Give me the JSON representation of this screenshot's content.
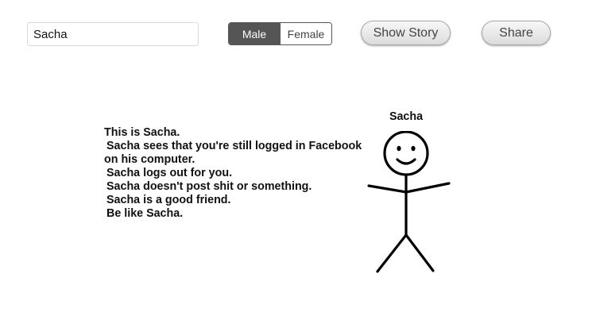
{
  "name_input": {
    "value": "Sacha"
  },
  "gender_toggle": {
    "options": [
      "Male",
      "Female"
    ],
    "selected": "Male"
  },
  "buttons": {
    "show_story": "Show Story",
    "share": "Share"
  },
  "figure": {
    "name": "Sacha",
    "icon": "stick-figure-smiling"
  },
  "story": {
    "lines": [
      "This is Sacha.",
      "Sacha sees that you're still logged in Facebook",
      "on his computer.",
      "Sacha logs out for you.",
      "Sacha doesn't post shit or something.",
      "Sacha is a good friend.",
      "Be like Sacha."
    ]
  },
  "colors": {
    "toggle_active_bg": "#555555",
    "text": "#111111"
  }
}
